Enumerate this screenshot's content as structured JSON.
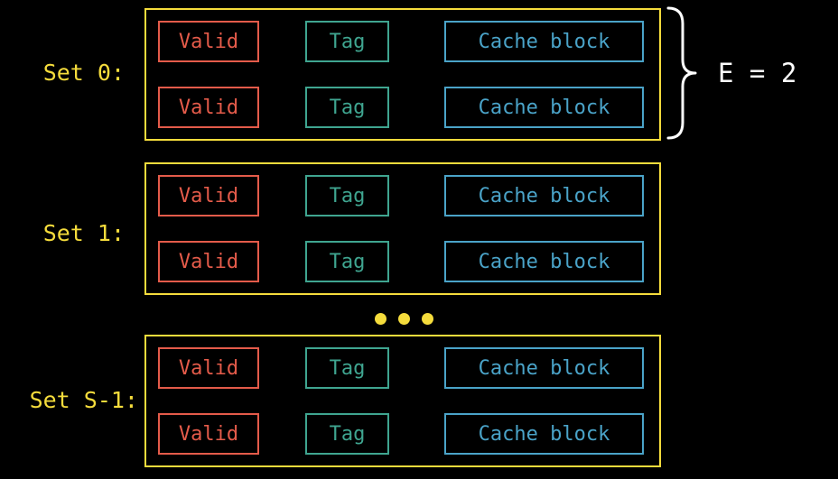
{
  "sets": [
    {
      "label": "Set 0:",
      "lines": [
        {
          "valid": "Valid",
          "tag": "Tag",
          "block": "Cache block"
        },
        {
          "valid": "Valid",
          "tag": "Tag",
          "block": "Cache block"
        }
      ]
    },
    {
      "label": "Set 1:",
      "lines": [
        {
          "valid": "Valid",
          "tag": "Tag",
          "block": "Cache block"
        },
        {
          "valid": "Valid",
          "tag": "Tag",
          "block": "Cache block"
        }
      ]
    },
    {
      "label": "Set S-1:",
      "lines": [
        {
          "valid": "Valid",
          "tag": "Tag",
          "block": "Cache block"
        },
        {
          "valid": "Valid",
          "tag": "Tag",
          "block": "Cache block"
        }
      ]
    }
  ],
  "lines_per_set_label": "E = 2",
  "colors": {
    "set": "#f5dc3c",
    "valid": "#e45b4a",
    "tag": "#3fa590",
    "cache_block": "#4aa3c8",
    "annotation": "#ffffff",
    "background": "#000000"
  }
}
